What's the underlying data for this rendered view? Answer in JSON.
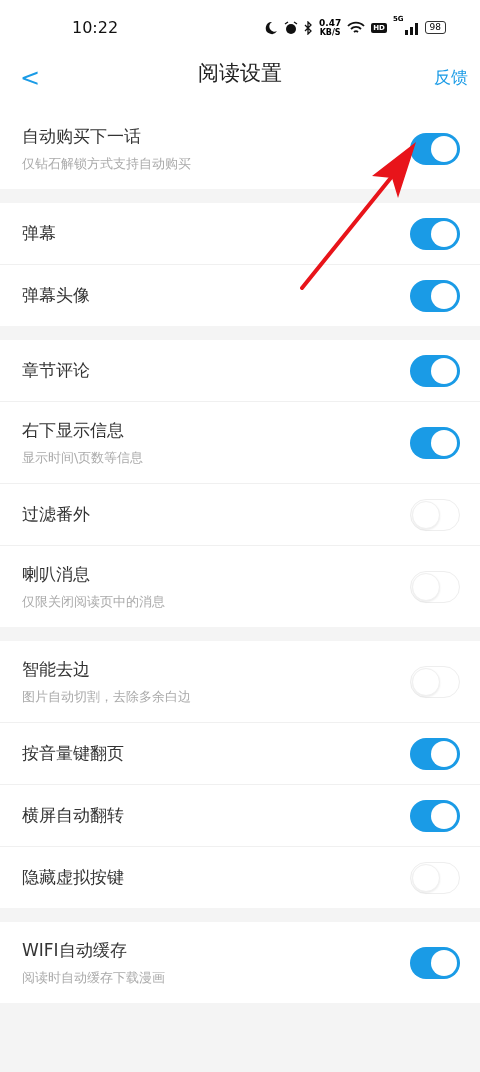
{
  "status_bar": {
    "time": "10:22",
    "speed_value": "0.47",
    "speed_unit": "KB/S",
    "hd": "HD",
    "network": "5G",
    "battery": "98"
  },
  "header": {
    "back": "<",
    "title": "阅读设置",
    "action": "反馈"
  },
  "groups": [
    {
      "items": [
        {
          "title": "自动购买下一话",
          "subtitle": "仅钻石解锁方式支持自动购买",
          "on": true
        }
      ]
    },
    {
      "items": [
        {
          "title": "弹幕",
          "on": true
        },
        {
          "title": "弹幕头像",
          "on": true
        }
      ]
    },
    {
      "items": [
        {
          "title": "章节评论",
          "on": true
        },
        {
          "title": "右下显示信息",
          "subtitle": "显示时间\\页数等信息",
          "on": true
        },
        {
          "title": "过滤番外",
          "on": false
        },
        {
          "title": "喇叭消息",
          "subtitle": "仅限关闭阅读页中的消息",
          "on": false
        }
      ]
    },
    {
      "items": [
        {
          "title": "智能去边",
          "subtitle": "图片自动切割，去除多余白边",
          "on": false
        },
        {
          "title": "按音量键翻页",
          "on": true
        },
        {
          "title": "横屏自动翻转",
          "on": true
        },
        {
          "title": "隐藏虚拟按键",
          "on": false
        }
      ]
    },
    {
      "items": [
        {
          "title": "WIFI自动缓存",
          "subtitle": "阅读时自动缓存下载漫画",
          "on": true
        }
      ]
    }
  ]
}
